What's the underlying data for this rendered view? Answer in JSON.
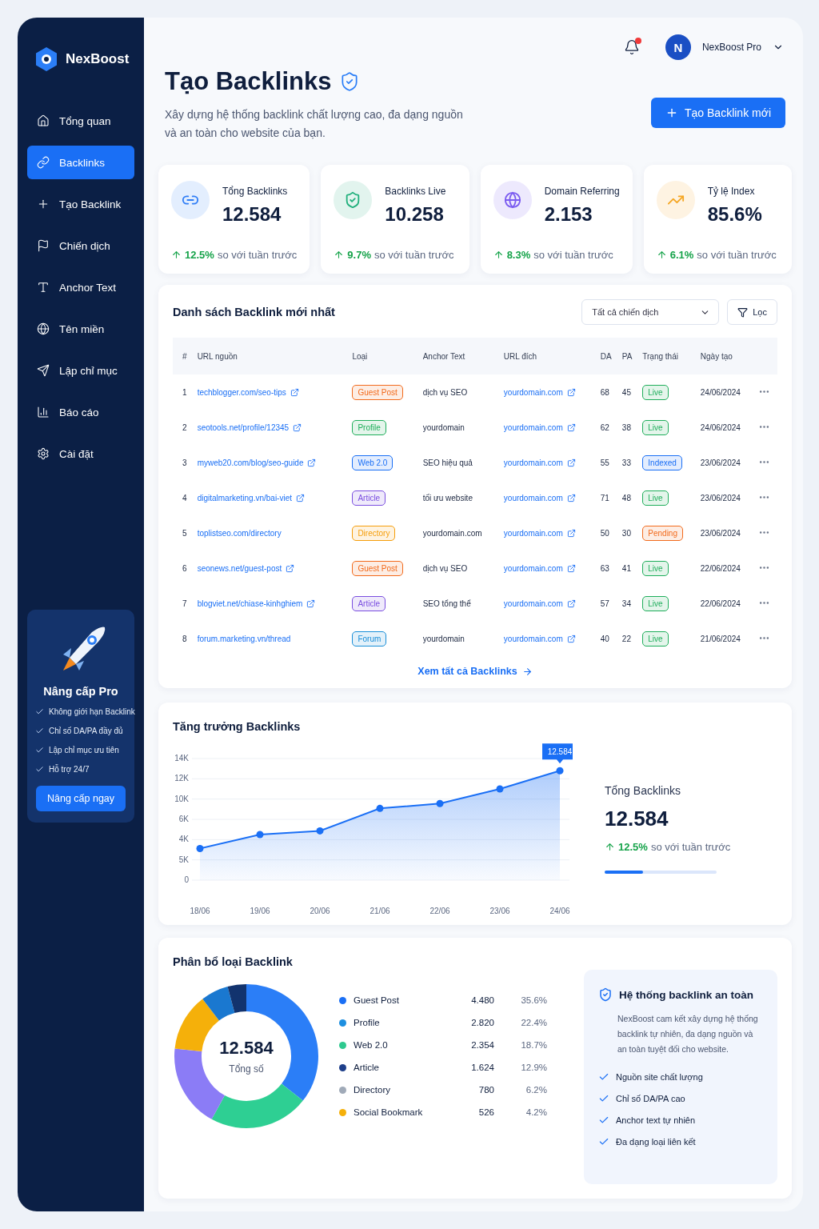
{
  "brand": {
    "name": "NexBoost"
  },
  "nav": [
    {
      "label": "Tổng quan",
      "selected": false
    },
    {
      "label": "Backlinks",
      "selected": true
    },
    {
      "label": "Tạo Backlink",
      "selected": false
    },
    {
      "label": "Chiến dịch",
      "selected": false
    },
    {
      "label": "Anchor Text",
      "selected": false
    },
    {
      "label": "Tên miền",
      "selected": false
    },
    {
      "label": "Lập chỉ mục",
      "selected": false
    },
    {
      "label": "Báo cáo",
      "selected": false
    },
    {
      "label": "Cài đặt",
      "selected": false
    }
  ],
  "promo": {
    "title": "Nâng cấp Pro",
    "features": [
      "Không giới hạn Backlink",
      "Chỉ số DA/PA đầy đủ",
      "Lập chỉ mục ưu tiên",
      "Hỗ trợ 24/7"
    ],
    "button": "Nâng cấp ngay"
  },
  "header": {
    "notification_dot": true,
    "avatar": "N",
    "user": "NexBoost Pro"
  },
  "page": {
    "title": "Tạo Backlinks",
    "subtitle": "Xây dựng hệ thống backlink chất lượng cao, đa dạng nguồn\nvà an toàn cho website của bạn.",
    "new_button": "Tạo Backlink mới"
  },
  "stats": [
    {
      "label": "Tổng Backlinks",
      "value": "12.584",
      "change": "12.5%",
      "compare": "so với tuần trước",
      "color": "#2f7df6"
    },
    {
      "label": "Backlinks Live",
      "value": "10.258",
      "change": "9.7%",
      "compare": "so với tuần trước",
      "color": "#22b07d"
    },
    {
      "label": "Domain Referring",
      "value": "2.153",
      "change": "8.3%",
      "compare": "so với tuần trước",
      "color": "#7b5cf0"
    },
    {
      "label": "Tỷ lệ Index",
      "value": "85.6%",
      "change": "6.1%",
      "compare": "so với tuần trước",
      "color": "#f5a623"
    }
  ],
  "table": {
    "title": "Danh sách Backlink mới nhất",
    "campaign_select": "Tất cả chiến dịch",
    "filter_button": "Lọc",
    "columns": [
      "#",
      "URL nguồn",
      "Loại",
      "Anchor Text",
      "URL đích",
      "DA",
      "PA",
      "Trạng thái",
      "Ngày tạo"
    ],
    "rows": [
      {
        "index": "1",
        "source": "techblogger.com/seo-tips",
        "source_link_icon": true,
        "type": {
          "label": "Guest Post",
          "color": "#f26b1d"
        },
        "anchor": "dịch vụ SEO",
        "target": "yourdomain.com",
        "da": "68",
        "pa": "45",
        "status": {
          "label": "Live",
          "color": "#1fae5b"
        },
        "date": "24/06/2024"
      },
      {
        "index": "2",
        "source": "seotools.net/profile/12345",
        "source_link_icon": true,
        "type": {
          "label": "Profile",
          "color": "#1fae5b"
        },
        "anchor": "yourdomain",
        "target": "yourdomain.com",
        "da": "62",
        "pa": "38",
        "status": {
          "label": "Live",
          "color": "#1fae5b"
        },
        "date": "24/06/2024"
      },
      {
        "index": "3",
        "source": "myweb20.com/blog/seo-guide",
        "source_link_icon": true,
        "type": {
          "label": "Web 2.0",
          "color": "#1a6ff5"
        },
        "anchor": "SEO hiệu quả",
        "target": "yourdomain.com",
        "da": "55",
        "pa": "33",
        "status": {
          "label": "Indexed",
          "color": "#1a6ff5"
        },
        "date": "23/06/2024"
      },
      {
        "index": "4",
        "source": "digitalmarketing.vn/bai-viet",
        "source_link_icon": true,
        "type": {
          "label": "Article",
          "color": "#7b4fe0"
        },
        "anchor": "tối ưu website",
        "target": "yourdomain.com",
        "da": "71",
        "pa": "48",
        "status": {
          "label": "Live",
          "color": "#1fae5b"
        },
        "date": "23/06/2024"
      },
      {
        "index": "5",
        "source": "toplistseo.com/directory",
        "source_link_icon": false,
        "type": {
          "label": "Directory",
          "color": "#f59e0b"
        },
        "anchor": "yourdomain.com",
        "target": "yourdomain.com",
        "da": "50",
        "pa": "30",
        "status": {
          "label": "Pending",
          "color": "#f26b1d"
        },
        "date": "23/06/2024"
      },
      {
        "index": "6",
        "source": "seonews.net/guest-post",
        "source_link_icon": true,
        "type": {
          "label": "Guest Post",
          "color": "#f26b1d"
        },
        "anchor": "dịch vụ SEO",
        "target": "yourdomain.com",
        "da": "63",
        "pa": "41",
        "status": {
          "label": "Live",
          "color": "#1fae5b"
        },
        "date": "22/06/2024"
      },
      {
        "index": "7",
        "source": "blogviet.net/chiase-kinhghiem",
        "source_link_icon": true,
        "type": {
          "label": "Article",
          "color": "#7b4fe0"
        },
        "anchor": "SEO tổng thể",
        "target": "yourdomain.com",
        "da": "57",
        "pa": "34",
        "status": {
          "label": "Live",
          "color": "#1fae5b"
        },
        "date": "22/06/2024"
      },
      {
        "index": "8",
        "source": "forum.marketing.vn/thread",
        "source_link_icon": false,
        "type": {
          "label": "Forum",
          "color": "#1a8fd8"
        },
        "anchor": "yourdomain",
        "target": "yourdomain.com",
        "da": "40",
        "pa": "22",
        "status": {
          "label": "Live",
          "color": "#1fae5b"
        },
        "date": "21/06/2024"
      }
    ],
    "view_all": "Xem tất cả Backlinks"
  },
  "growth": {
    "title": "Tăng trưởng Backlinks",
    "tooltip": "12.584",
    "y_labels": [
      "14K",
      "12K",
      "10K",
      "6K",
      "4K",
      "5K",
      "0"
    ],
    "x_labels": [
      "18/06",
      "19/06",
      "20/06",
      "21/06",
      "22/06",
      "23/06",
      "24/06"
    ],
    "summary": {
      "label": "Tổng Backlinks",
      "value": "12.584",
      "change": "12.5%",
      "compare": "so với tuần trước",
      "level": 0.34
    }
  },
  "distribution": {
    "title": "Phân bổ loại Backlink",
    "center_value": "12.584",
    "center_label": "Tổng số",
    "chart_data": {
      "type": "donut",
      "categories": [
        "Guest Post",
        "Profile",
        "Web 2.0",
        "Article",
        "Directory",
        "Social Bookmark"
      ],
      "values": [
        35.6,
        22.4,
        18.7,
        12.9,
        6.2,
        4.2
      ],
      "colors": [
        "#2b7ef7",
        "#2ecf93",
        "#8b7cf6",
        "#f5b00a",
        "#1a78d0",
        "#12336e"
      ]
    },
    "legend": [
      {
        "count": "4.480",
        "percent": "35.6%",
        "color": "#1a6ff5"
      },
      {
        "count": "2.820",
        "percent": "22.4%",
        "color": "#1d8fe0"
      },
      {
        "count": "2.354",
        "percent": "18.7%",
        "color": "#2ec98f"
      },
      {
        "count": "1.624",
        "percent": "12.9%",
        "color": "#1e3f8a"
      },
      {
        "count": "780",
        "percent": "6.2%",
        "color": "#a0aab8"
      },
      {
        "count": "526",
        "percent": "4.2%",
        "color": "#f5b00a"
      }
    ]
  },
  "safety": {
    "title": "Hệ thống backlink an toàn",
    "text": "NexBoost cam kết xây dựng hệ thống backlink tự nhiên, đa dạng nguồn và an toàn tuyệt đối cho website.",
    "points": [
      "Nguồn site chất lượng",
      "Chỉ số DA/PA cao",
      "Anchor text tự nhiên",
      "Đa dạng loại liên kết"
    ]
  }
}
